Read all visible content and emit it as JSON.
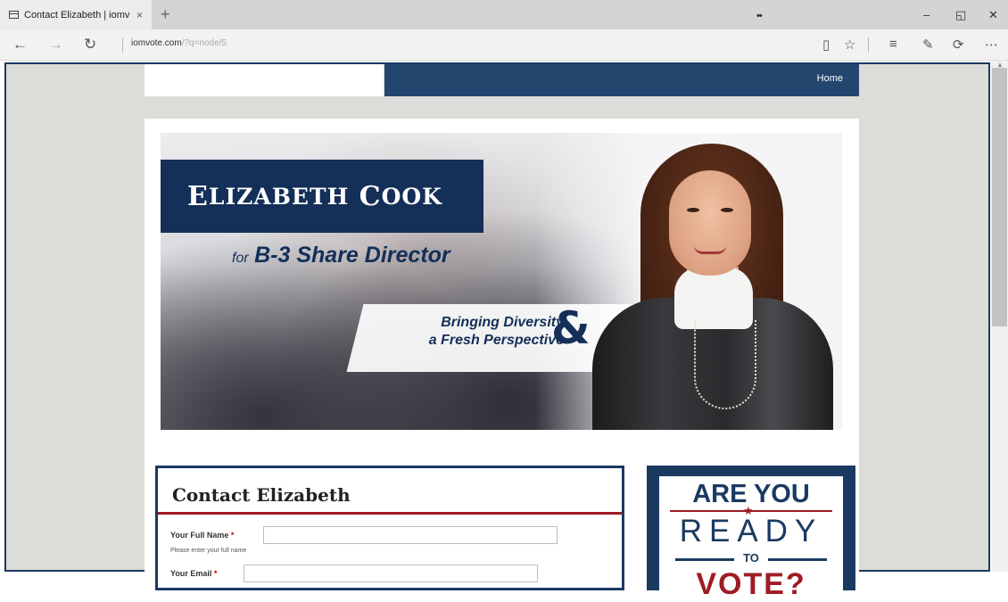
{
  "browser": {
    "tab_title": "Contact Elizabeth | iomv",
    "tab_close": "×",
    "new_tab": "+",
    "center_dots": "••",
    "window_controls": {
      "minimize": "–",
      "restore": "◱",
      "close": "✕"
    },
    "url_host": "iomvote.com",
    "url_path": "/?q=node/5",
    "nav": {
      "back": "←",
      "forward": "→",
      "refresh": "↻"
    },
    "tools": [
      "reading-view-icon",
      "favorite-star-icon",
      "hub-icon",
      "web-note-icon",
      "share-icon",
      "more-icon"
    ]
  },
  "site": {
    "nav_home": "Home",
    "banner": {
      "name_initial_1": "E",
      "name_rest_1": "LIZABETH",
      "name_initial_2": "C",
      "name_rest_2": "OOK",
      "for_word": "for",
      "position": "B-3 Share Director",
      "slogan_line1": "Bringing Diversity",
      "slogan_line2": "a Fresh Perspective",
      "ampersand": "&"
    },
    "contact": {
      "title": "Contact Elizabeth",
      "name_label": "Your Full Name",
      "name_help": "Please enter your full name",
      "email_label": "Your Email",
      "required_mark": "*"
    },
    "vote": {
      "line1": "ARE YOU",
      "star": "★",
      "line2": "READY",
      "to": "TO",
      "line3": "VOTE?"
    }
  },
  "colors": {
    "navy": "#1a3a62",
    "banner_navy": "#142f58",
    "red": "#9e1c24",
    "page_bg": "#dcdcd8"
  }
}
